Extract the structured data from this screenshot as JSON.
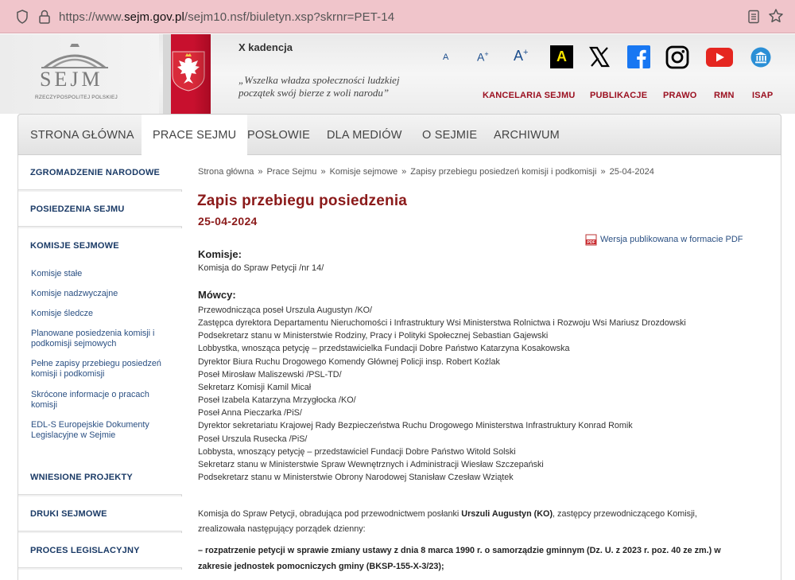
{
  "browser": {
    "url_prefix": "https://www.",
    "url_domain": "sejm.gov.pl",
    "url_path": "/sejm10.nsf/biuletyn.xsp?skrnr=PET-14"
  },
  "header": {
    "logo_text": "SEJM",
    "logo_subtext": "RZECZYPOSPOLITEJ POLSKIEJ",
    "kadencja": "X kadencja",
    "motto_line1": "„Wszelka władza społeczności ludzkiej",
    "motto_line2": "początek swój bierze z woli narodu”",
    "font_small": "A",
    "font_medium": "A",
    "font_large": "A",
    "font_plus": "+",
    "contrast_label": "A",
    "top_links": [
      "KANCELARIA SEJMU",
      "PUBLIKACJE",
      "PRAWO",
      "RMN",
      "ISAP"
    ]
  },
  "mainnav": [
    "STRONA GŁÓWNA",
    "PRACE SEJMU",
    "POSŁOWIE",
    "DLA MEDIÓW",
    "O SEJMIE",
    "ARCHIWUM"
  ],
  "sidebar": {
    "zgromadzenie": "ZGROMADZENIE NARODOWE",
    "posiedzenia": "POSIEDZENIA SEJMU",
    "komisje": "KOMISJE SEJMOWE",
    "sub": [
      "Komisje stałe",
      "Komisje nadzwyczajne",
      "Komisje śledcze",
      "Planowane posiedzenia komisji i podkomisji sejmowych",
      "Pełne zapisy przebiegu posiedzeń komisji i podkomisji",
      "Skrócone informacje o pracach komisji",
      "EDL-S Europejskie Dokumenty Legislacyjne w Sejmie"
    ],
    "wniesione": "WNIESIONE PROJEKTY",
    "druki": "DRUKI SEJMOWE",
    "proces": "PROCES LEGISLACYJNY"
  },
  "breadcrumb": [
    "Strona główna",
    "Prace Sejmu",
    "Komisje sejmowe",
    "Zapisy przebiegu posiedzeń komisji i podkomisji",
    "25-04-2024"
  ],
  "breadcrumb_sep": "»",
  "content": {
    "title": "Zapis przebiegu posiedzenia",
    "date": "25-04-2024",
    "pdf_label": "Wersja publikowana w formacie PDF",
    "pdf_icon_text": "PDF",
    "komisje_heading": "Komisje:",
    "komisja": "Komisja do Spraw Petycji /nr 14/",
    "mowcy_heading": "Mówcy:",
    "speakers": [
      "Przewodnicząca poseł Urszula Augustyn /KO/",
      "Zastępca dyrektora Departamentu Nieruchomości i Infrastruktury Wsi Ministerstwa Rolnictwa i Rozwoju Wsi Mariusz Drozdowski",
      "Podsekretarz stanu w Ministerstwie Rodziny, Pracy i Polityki Społecznej Sebastian Gajewski",
      "Lobbystka, wnosząca petycję – przedstawicielka Fundacji Dobre Państwo Katarzyna Kosakowska",
      "Dyrektor Biura Ruchu Drogowego Komendy Głównej Policji insp. Robert Koźlak",
      "Poseł Mirosław Maliszewski /PSL-TD/",
      "Sekretarz Komisji Kamil Micał",
      "Poseł Izabela Katarzyna Mrzygłocka /KO/",
      "Poseł Anna Pieczarka /PiS/",
      "Dyrektor sekretariatu Krajowej Rady Bezpieczeństwa Ruchu Drogowego Ministerstwa Infrastruktury Konrad Romik",
      "Poseł Urszula Rusecka /PiS/",
      "Lobbysta, wnoszący petycję – przedstawiciel Fundacji Dobre Państwo Witold Solski",
      "Sekretarz stanu w Ministerstwie Spraw Wewnętrznych i Administracji Wiesław Szczepański",
      "Podsekretarz stanu w Ministerstwie Obrony Narodowej Stanisław Czesław Wziątek"
    ],
    "para_part1": "Komisja do Spraw Petycji, obradująca pod przewodnictwem posłanki ",
    "para_bold": "Urszuli Augustyn (KO)",
    "para_part2": ", zastępcy przewodniczącego Komisji, zrealizowała następujący porządek dzienny:",
    "agenda": "– rozpatrzenie petycji w sprawie zmiany ustawy z dnia 8 marca 1990 r. o samorządzie gminnym (Dz. U. z 2023 r. poz. 40 ze zm.) w zakresie jednostek pomocniczych gminy (BKSP-155-X-3/23);"
  },
  "colors": {
    "accent_red": "#8b1a1a",
    "nav_red": "#9b1020",
    "link_blue": "#2a4f82",
    "sidebar_head": "#1a3a66"
  }
}
